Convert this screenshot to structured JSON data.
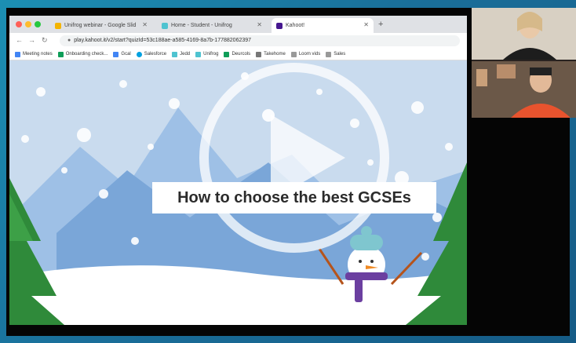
{
  "browser": {
    "tabs": [
      {
        "title": "Unifrog webinar - Google Slid",
        "color": "#f4b400",
        "active": false
      },
      {
        "title": "Home - Student - Unifrog",
        "color": "#4fc3d0",
        "active": false
      },
      {
        "title": "Kahoot!",
        "color": "#46178f",
        "active": true
      }
    ],
    "url": "play.kahoot.it/v2/start?quizId=53c188ae-a585-4169-8a7b-177882062397",
    "bookmarks": [
      {
        "label": "Meeting notes",
        "color": "#4285f4"
      },
      {
        "label": "Onboarding check...",
        "color": "#0f9d58"
      },
      {
        "label": "Gcal",
        "color": "#4285f4"
      },
      {
        "label": "Salesforce",
        "color": "#00a1e0"
      },
      {
        "label": "Jedd",
        "color": "#4fc3d0"
      },
      {
        "label": "Unifrog",
        "color": "#4fc3d0"
      },
      {
        "label": "Deurcols",
        "color": "#0f9d58"
      },
      {
        "label": "Takehome",
        "color": "#777777"
      },
      {
        "label": "Loom vids",
        "color": "#777777"
      },
      {
        "label": "Sales",
        "color": "#777777"
      }
    ]
  },
  "slide": {
    "caption": "How to choose the best GCSEs"
  },
  "colors": {
    "sky": "#c9dbee",
    "tree": "#2f8a3a",
    "scarf": "#6b3fa0",
    "hat": "#7fc6cf"
  },
  "icons": {
    "play": "play-icon",
    "back": "back-arrow-icon",
    "forward": "forward-arrow-icon",
    "reload": "reload-icon",
    "lock": "lock-icon"
  }
}
